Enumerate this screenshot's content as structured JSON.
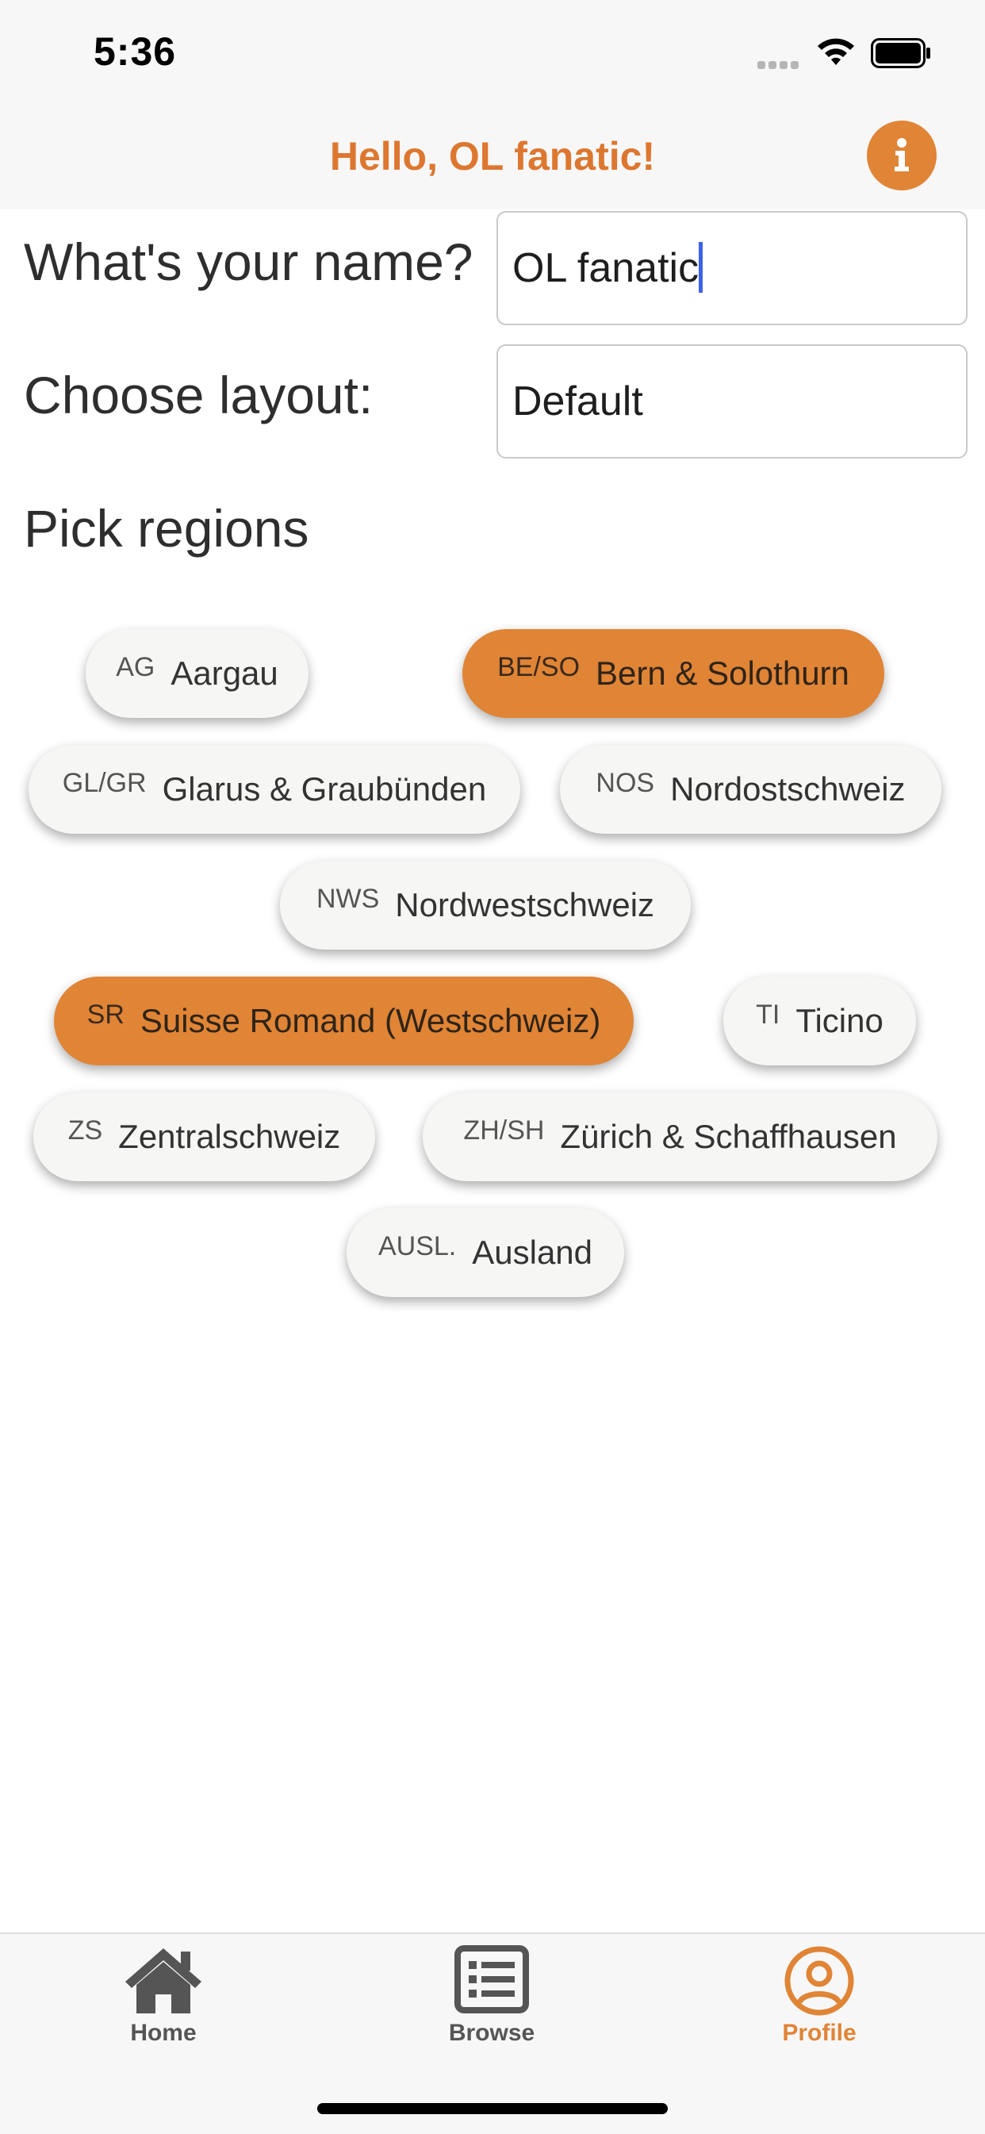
{
  "status_bar": {
    "time": "5:36"
  },
  "header": {
    "title": "Hello, OL fanatic!",
    "info_icon": "info-icon",
    "accent": "#e08436"
  },
  "form": {
    "name_label": "What's your name?",
    "name_value": "OL fanatic",
    "layout_label": "Choose layout:",
    "layout_value": "Default"
  },
  "regions": {
    "title": "Pick regions",
    "items": [
      {
        "code": "AG",
        "name": "Aargau",
        "selected": false
      },
      {
        "code": "BE/SO",
        "name": "Bern & Solothurn",
        "selected": true
      },
      {
        "code": "GL/GR",
        "name": "Glarus & Graubünden",
        "selected": false
      },
      {
        "code": "NOS",
        "name": "Nordostschweiz",
        "selected": false
      },
      {
        "code": "NWS",
        "name": "Nordwestschweiz",
        "selected": false
      },
      {
        "code": "SR",
        "name": "Suisse Romand (Westschweiz)",
        "selected": true
      },
      {
        "code": "TI",
        "name": "Ticino",
        "selected": false
      },
      {
        "code": "ZS",
        "name": "Zentralschweiz",
        "selected": false
      },
      {
        "code": "ZH/SH",
        "name": "Zürich & Schaffhausen",
        "selected": false
      },
      {
        "code": "AUSL.",
        "name": "Ausland",
        "selected": false
      }
    ]
  },
  "tabs": [
    {
      "label": "Home",
      "icon": "home-icon",
      "active": false
    },
    {
      "label": "Browse",
      "icon": "list-icon",
      "active": false
    },
    {
      "label": "Profile",
      "icon": "profile-icon",
      "active": true
    }
  ]
}
